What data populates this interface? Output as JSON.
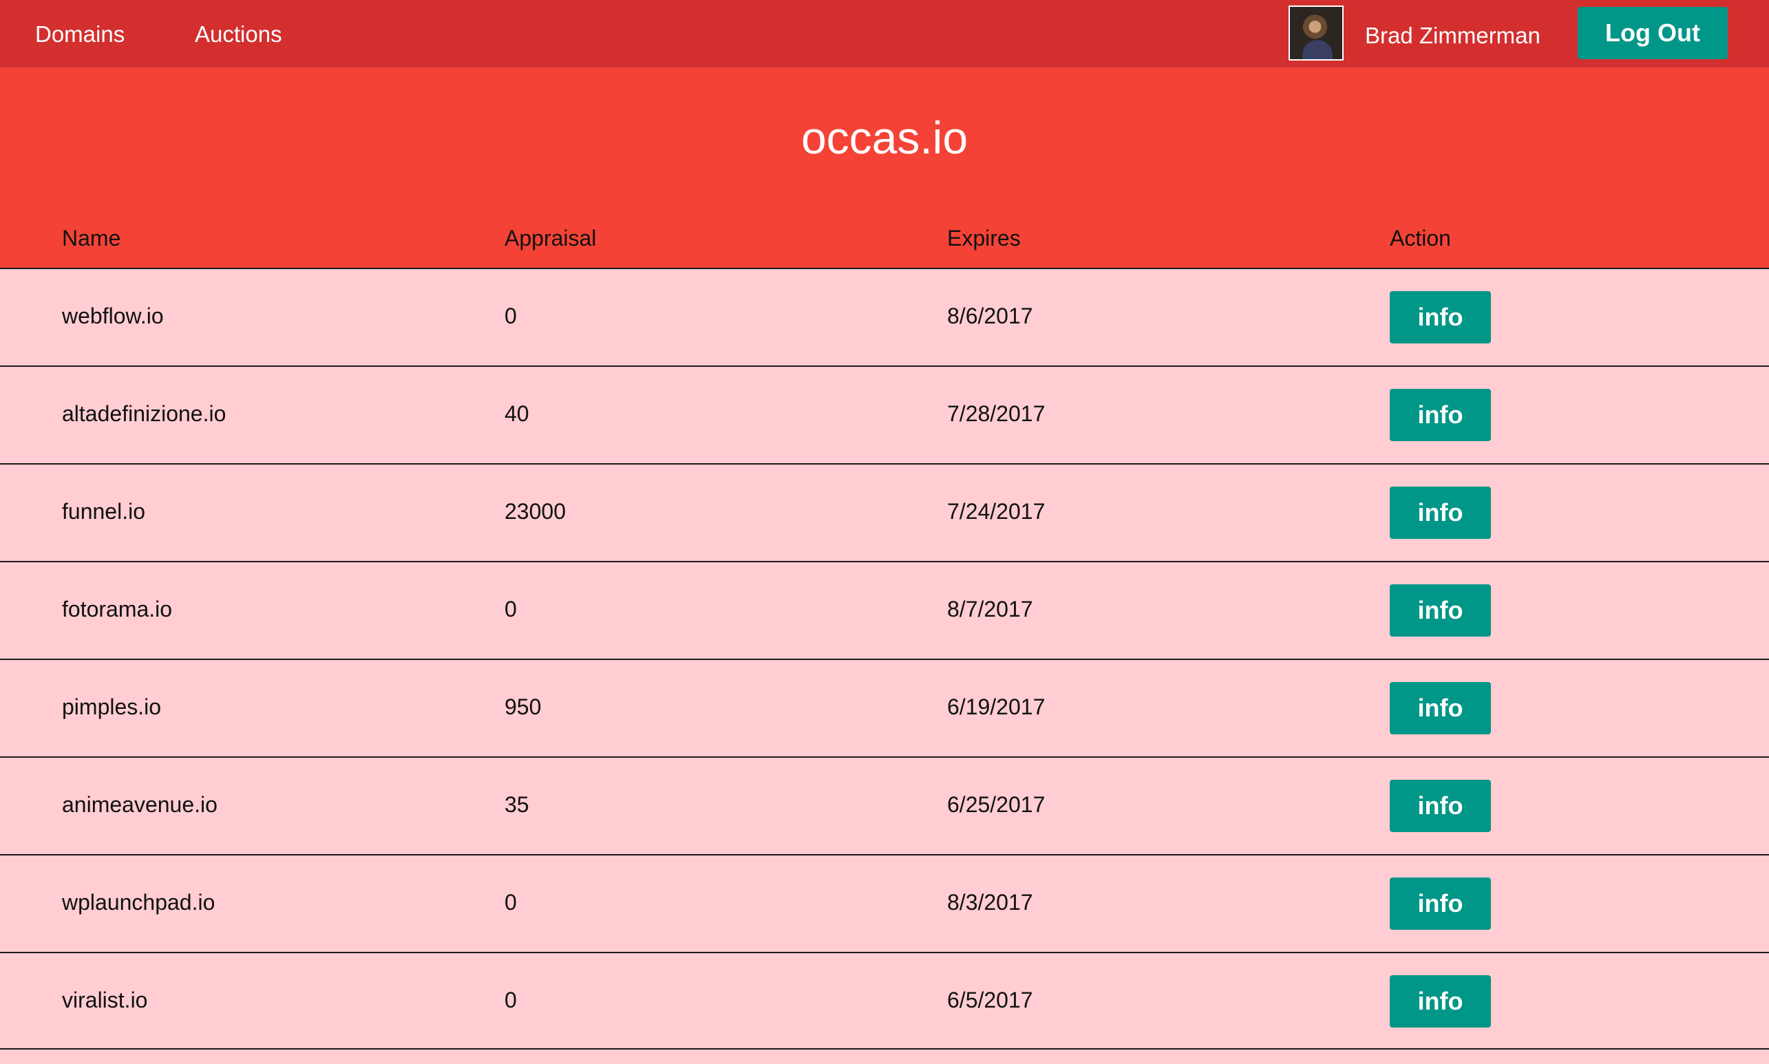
{
  "nav": {
    "links": [
      {
        "label": "Domains"
      },
      {
        "label": "Auctions"
      }
    ],
    "user_name": "Brad Zimmerman",
    "logout_label": "Log Out"
  },
  "header": {
    "title": "occas.io"
  },
  "table": {
    "columns": [
      "Name",
      "Appraisal",
      "Expires",
      "Action"
    ],
    "rows": [
      {
        "name": "webflow.io",
        "appraisal": "0",
        "expires": "8/6/2017",
        "action": "info"
      },
      {
        "name": "altadefinizione.io",
        "appraisal": "40",
        "expires": "7/28/2017",
        "action": "info"
      },
      {
        "name": "funnel.io",
        "appraisal": "23000",
        "expires": "7/24/2017",
        "action": "info"
      },
      {
        "name": "fotorama.io",
        "appraisal": "0",
        "expires": "8/7/2017",
        "action": "info"
      },
      {
        "name": "pimples.io",
        "appraisal": "950",
        "expires": "6/19/2017",
        "action": "info"
      },
      {
        "name": "animeavenue.io",
        "appraisal": "35",
        "expires": "6/25/2017",
        "action": "info"
      },
      {
        "name": "wplaunchpad.io",
        "appraisal": "0",
        "expires": "8/3/2017",
        "action": "info"
      },
      {
        "name": "viralist.io",
        "appraisal": "0",
        "expires": "6/5/2017",
        "action": "info"
      }
    ]
  },
  "colors": {
    "nav_bg": "#d32f2f",
    "header_bg": "#f44336",
    "table_bg": "#ffcdd2",
    "button_bg": "#009688"
  }
}
